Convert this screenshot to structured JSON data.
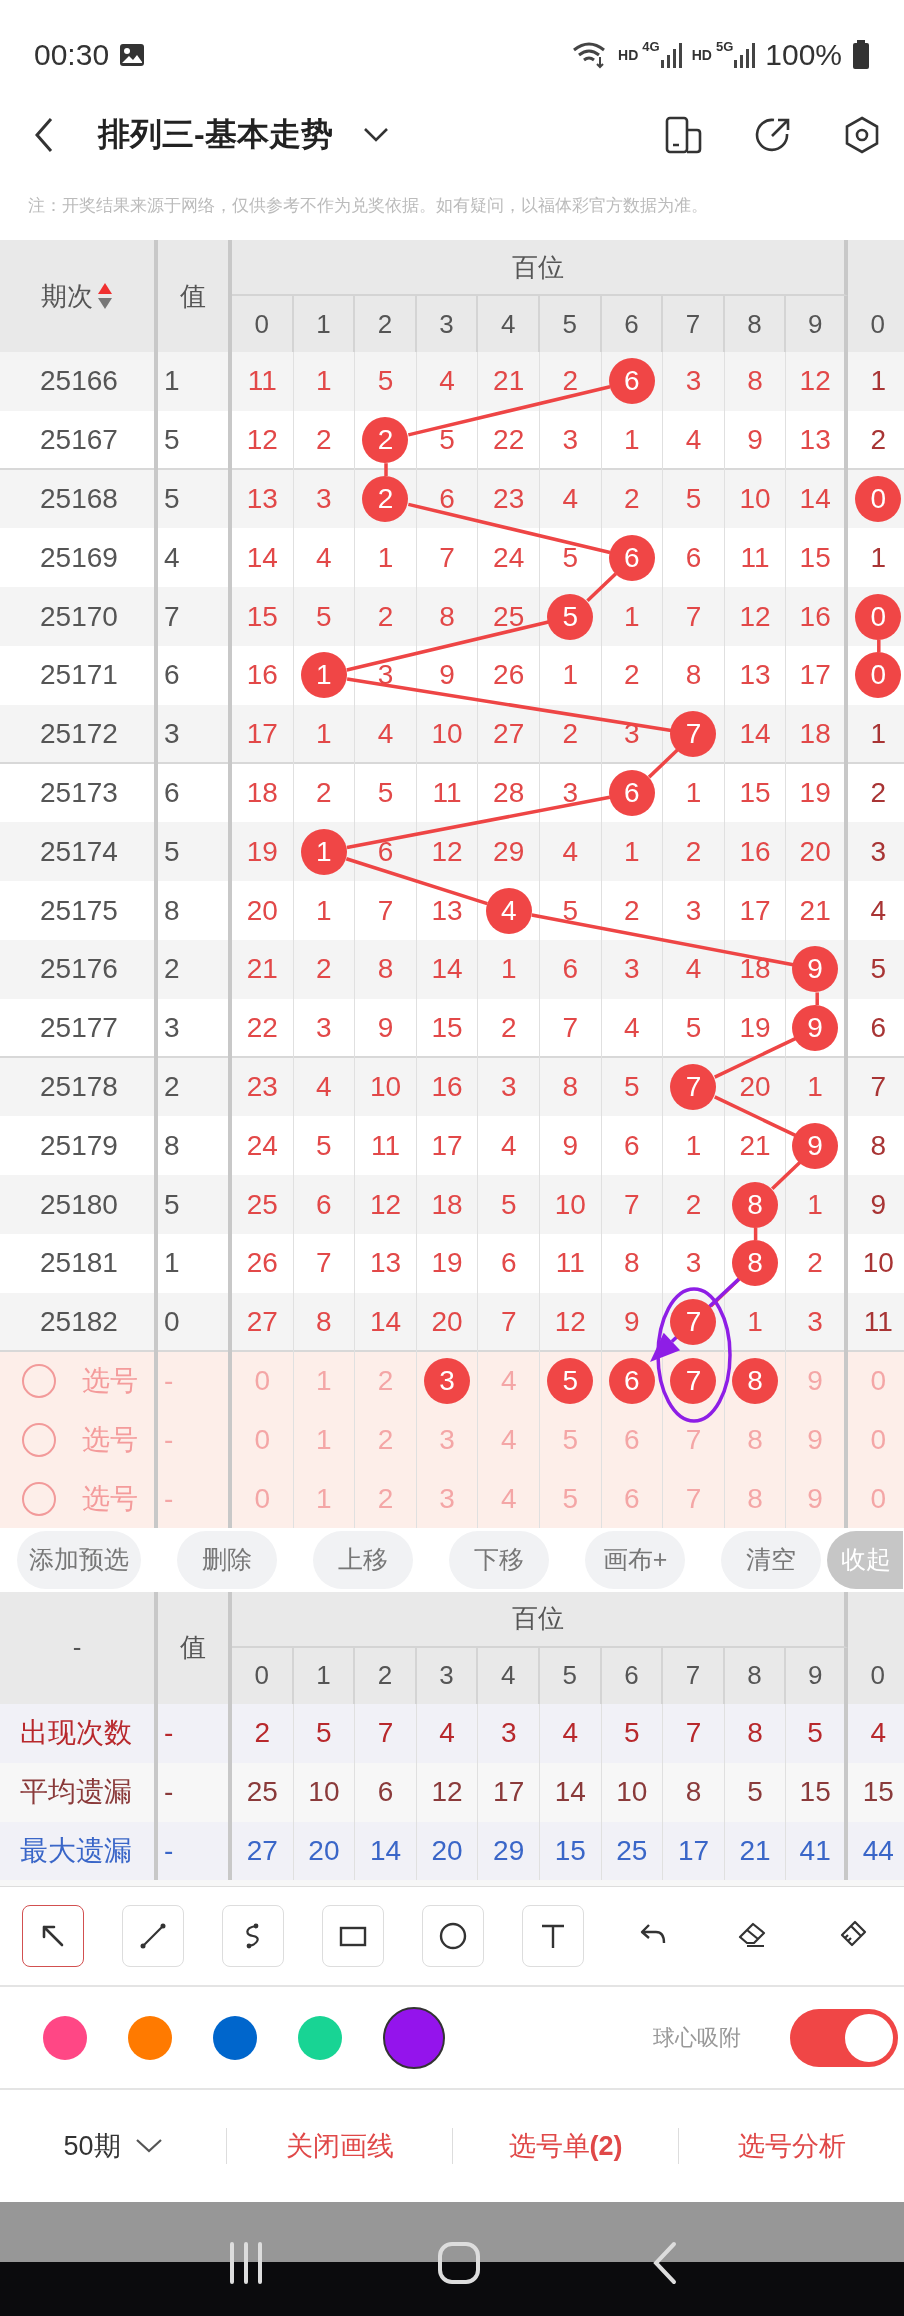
{
  "status_bar": {
    "time": "00:30",
    "networks": [
      {
        "label": "HD",
        "type": "4G"
      },
      {
        "label": "HD",
        "type": "5G"
      }
    ],
    "battery": "100%"
  },
  "app_bar": {
    "title": "排列三-基本走势"
  },
  "notice": "注：开奖结果来源于网络，仅供参考不作为兑奖依据。如有疑问，以福体彩官方数据为准。",
  "trend_table": {
    "header": {
      "period": "期次",
      "sum": "值",
      "group": "百位",
      "digits": [
        "0",
        "1",
        "2",
        "3",
        "4",
        "5",
        "6",
        "7",
        "8",
        "9",
        "0"
      ]
    },
    "rows": [
      {
        "period": "25166",
        "sum": "1",
        "cells": [
          "11",
          "1",
          "5",
          "4",
          "21",
          "2",
          {
            "ball": "6"
          },
          "3",
          "8",
          "12",
          "1"
        ]
      },
      {
        "period": "25167",
        "sum": "5",
        "cells": [
          "12",
          "2",
          {
            "ball": "2"
          },
          "5",
          "22",
          "3",
          "1",
          "4",
          "9",
          "13",
          "2"
        ]
      },
      {
        "period": "25168",
        "sum": "5",
        "cells": [
          "13",
          "3",
          {
            "ball": "2"
          },
          "6",
          "23",
          "4",
          "2",
          "5",
          "10",
          "14",
          {
            "ball": "0"
          }
        ]
      },
      {
        "period": "25169",
        "sum": "4",
        "cells": [
          "14",
          "4",
          "1",
          "7",
          "24",
          "5",
          {
            "ball": "6"
          },
          "6",
          "11",
          "15",
          "1"
        ]
      },
      {
        "period": "25170",
        "sum": "7",
        "cells": [
          "15",
          "5",
          "2",
          "8",
          "25",
          {
            "ball": "5"
          },
          "1",
          "7",
          "12",
          "16",
          {
            "ball": "0"
          }
        ]
      },
      {
        "period": "25171",
        "sum": "6",
        "cells": [
          "16",
          {
            "ball": "1"
          },
          "3",
          "9",
          "26",
          "1",
          "2",
          "8",
          "13",
          "17",
          {
            "ball": "0"
          }
        ]
      },
      {
        "period": "25172",
        "sum": "3",
        "cells": [
          "17",
          "1",
          "4",
          "10",
          "27",
          "2",
          "3",
          {
            "ball": "7"
          },
          "14",
          "18",
          "1"
        ]
      },
      {
        "period": "25173",
        "sum": "6",
        "cells": [
          "18",
          "2",
          "5",
          "11",
          "28",
          "3",
          {
            "ball": "6"
          },
          "1",
          "15",
          "19",
          "2"
        ]
      },
      {
        "period": "25174",
        "sum": "5",
        "cells": [
          "19",
          {
            "ball": "1"
          },
          "6",
          "12",
          "29",
          "4",
          "1",
          "2",
          "16",
          "20",
          "3"
        ]
      },
      {
        "period": "25175",
        "sum": "8",
        "cells": [
          "20",
          "1",
          "7",
          "13",
          {
            "ball": "4"
          },
          "5",
          "2",
          "3",
          "17",
          "21",
          "4"
        ]
      },
      {
        "period": "25176",
        "sum": "2",
        "cells": [
          "21",
          "2",
          "8",
          "14",
          "1",
          "6",
          "3",
          "4",
          "18",
          {
            "ball": "9"
          },
          "5"
        ]
      },
      {
        "period": "25177",
        "sum": "3",
        "cells": [
          "22",
          "3",
          "9",
          "15",
          "2",
          "7",
          "4",
          "5",
          "19",
          {
            "ball": "9"
          },
          "6"
        ]
      },
      {
        "period": "25178",
        "sum": "2",
        "cells": [
          "23",
          "4",
          "10",
          "16",
          "3",
          "8",
          "5",
          {
            "ball": "7"
          },
          "20",
          "1",
          "7"
        ]
      },
      {
        "period": "25179",
        "sum": "8",
        "cells": [
          "24",
          "5",
          "11",
          "17",
          "4",
          "9",
          "6",
          "1",
          "21",
          {
            "ball": "9"
          },
          "8"
        ]
      },
      {
        "period": "25180",
        "sum": "5",
        "cells": [
          "25",
          "6",
          "12",
          "18",
          "5",
          "10",
          "7",
          "2",
          {
            "ball": "8"
          },
          "1",
          "9"
        ]
      },
      {
        "period": "25181",
        "sum": "1",
        "cells": [
          "26",
          "7",
          "13",
          "19",
          "6",
          "11",
          "8",
          "3",
          {
            "ball": "8"
          },
          "2",
          "10"
        ]
      },
      {
        "period": "25182",
        "sum": "0",
        "cells": [
          "27",
          "8",
          "14",
          "20",
          "7",
          "12",
          "9",
          {
            "ball": "7"
          },
          "1",
          "3",
          "11"
        ]
      }
    ],
    "pick_rows": [
      {
        "label": "选号",
        "checked": false,
        "sum": "-",
        "digits": [
          {
            "text": "0",
            "selected": false
          },
          {
            "text": "1",
            "selected": false
          },
          {
            "text": "2",
            "selected": false
          },
          {
            "text": "3",
            "selected": true
          },
          {
            "text": "4",
            "selected": false
          },
          {
            "text": "5",
            "selected": true
          },
          {
            "text": "6",
            "selected": true
          },
          {
            "text": "7",
            "selected": true
          },
          {
            "text": "8",
            "selected": true
          },
          {
            "text": "9",
            "selected": false
          },
          {
            "text": "0",
            "selected": false
          }
        ]
      },
      {
        "label": "选号",
        "checked": false,
        "sum": "-",
        "digits": [
          {
            "text": "0",
            "selected": false
          },
          {
            "text": "1",
            "selected": false
          },
          {
            "text": "2",
            "selected": false
          },
          {
            "text": "3",
            "selected": false
          },
          {
            "text": "4",
            "selected": false
          },
          {
            "text": "5",
            "selected": false
          },
          {
            "text": "6",
            "selected": false
          },
          {
            "text": "7",
            "selected": false
          },
          {
            "text": "8",
            "selected": false
          },
          {
            "text": "9",
            "selected": false
          },
          {
            "text": "0",
            "selected": false
          }
        ]
      },
      {
        "label": "选号",
        "checked": false,
        "sum": "-",
        "digits": [
          {
            "text": "0",
            "selected": false
          },
          {
            "text": "1",
            "selected": false
          },
          {
            "text": "2",
            "selected": false
          },
          {
            "text": "3",
            "selected": false
          },
          {
            "text": "4",
            "selected": false
          },
          {
            "text": "5",
            "selected": false
          },
          {
            "text": "6",
            "selected": false
          },
          {
            "text": "7",
            "selected": false
          },
          {
            "text": "8",
            "selected": false
          },
          {
            "text": "9",
            "selected": false
          },
          {
            "text": "0",
            "selected": false
          }
        ]
      }
    ]
  },
  "actions": [
    {
      "label": "添加预选",
      "kind": "light"
    },
    {
      "label": "删除",
      "kind": "light"
    },
    {
      "label": "上移",
      "kind": "light"
    },
    {
      "label": "下移",
      "kind": "light"
    },
    {
      "label": "画布+",
      "kind": "light"
    },
    {
      "label": "清空",
      "kind": "light"
    },
    {
      "label": "收起",
      "kind": "dark"
    }
  ],
  "stats_table": {
    "header": {
      "period": "-",
      "sum": "值",
      "group": "百位",
      "digits": [
        "0",
        "1",
        "2",
        "3",
        "4",
        "5",
        "6",
        "7",
        "8",
        "9",
        "0"
      ]
    },
    "rows": [
      {
        "label": "出现次数",
        "color": "#b8282c",
        "sum": "-",
        "values": [
          "2",
          "5",
          "7",
          "4",
          "3",
          "4",
          "5",
          "7",
          "8",
          "5",
          "4"
        ]
      },
      {
        "label": "平均遗漏",
        "color": "#8a3a3a",
        "sum": "-",
        "values": [
          "25",
          "10",
          "6",
          "12",
          "17",
          "14",
          "10",
          "8",
          "5",
          "15",
          "15"
        ]
      },
      {
        "label": "最大遗漏",
        "color": "#3a66c8",
        "sum": "-",
        "values": [
          "27",
          "20",
          "14",
          "20",
          "29",
          "15",
          "25",
          "17",
          "21",
          "41",
          "44"
        ]
      }
    ]
  },
  "tools": [
    {
      "kind": "tool",
      "selected": true
    },
    {
      "kind": "tool",
      "selected": false
    },
    {
      "kind": "tool",
      "selected": false
    },
    {
      "kind": "tool",
      "selected": false
    },
    {
      "kind": "tool",
      "selected": false
    },
    {
      "kind": "tool",
      "selected": false
    },
    {
      "kind": "action",
      "selected": false
    },
    {
      "kind": "action",
      "selected": false
    },
    {
      "kind": "action",
      "selected": false
    }
  ],
  "palette": [
    {
      "color": "#ff4785",
      "selected": false
    },
    {
      "color": "#ff7a00",
      "selected": false
    },
    {
      "color": "#0066cc",
      "selected": false
    },
    {
      "color": "#18d494",
      "selected": false
    },
    {
      "color": "#9414ec",
      "selected": true
    }
  ],
  "snap": {
    "label": "球心吸附",
    "on": true
  },
  "bottom_bar": [
    {
      "label": "50期",
      "kind": "dropdown"
    },
    {
      "label": "关闭画线",
      "kind": "link"
    },
    {
      "label": "选号单**(2)**",
      "kind": "link"
    },
    {
      "label": "选号分析",
      "kind": "link"
    }
  ]
}
